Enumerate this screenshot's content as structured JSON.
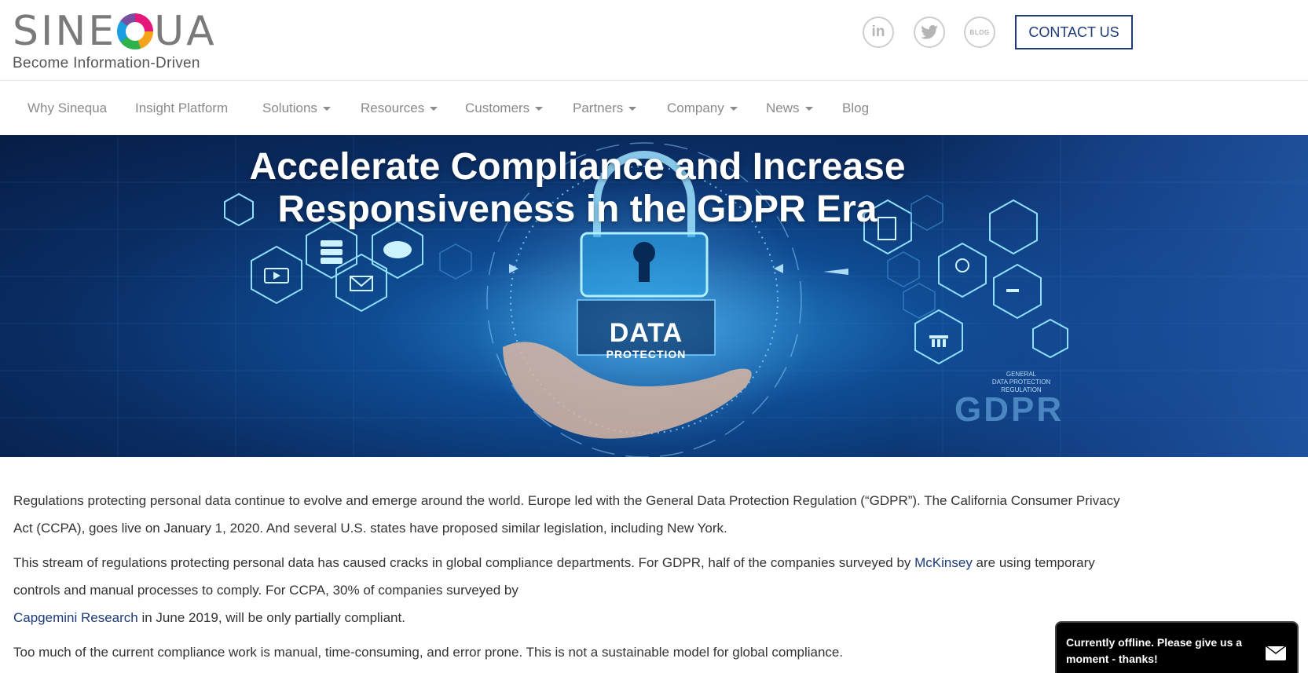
{
  "brand": {
    "logo_pre": "SINE",
    "logo_post": "UA",
    "tagline": "Become Information-Driven"
  },
  "header": {
    "social": [
      {
        "label": "in",
        "icon": "linkedin-icon"
      },
      {
        "label": "🐦",
        "icon": "twitter-icon"
      },
      {
        "label": "BLOG",
        "icon": "blog-icon"
      }
    ],
    "contact_label": "CONTACT US"
  },
  "nav": {
    "items": [
      {
        "label": "Why Sinequa",
        "dropdown": false
      },
      {
        "label": "Insight Platform",
        "dropdown": false
      },
      {
        "label": "Solutions",
        "dropdown": true
      },
      {
        "label": "Resources",
        "dropdown": true
      },
      {
        "label": "Customers",
        "dropdown": true
      },
      {
        "label": "Partners",
        "dropdown": true
      },
      {
        "label": "Company",
        "dropdown": true
      },
      {
        "label": "News",
        "dropdown": true
      },
      {
        "label": "Blog",
        "dropdown": false
      }
    ]
  },
  "hero": {
    "title_line1": "Accelerate Compliance and Increase",
    "title_line2": "Responsiveness in the GDPR Era",
    "data_big": "DATA",
    "data_small": "PROTECTION",
    "gdpr_small_1": "GENERAL",
    "gdpr_small_2": "DATA PROTECTION",
    "gdpr_small_3": "REGULATION",
    "gdpr_big": "GDPR"
  },
  "content": {
    "p1": "Regulations protecting personal data continue to evolve and emerge around the world. Europe led with the General Data Protection Regulation (“GDPR”). The California Consumer Privacy Act (CCPA), goes live on January 1, 2020. And several U.S. states have proposed similar legislation, including New York.",
    "p2_a": "This stream of regulations protecting personal data has caused cracks in global compliance departments. For GDPR, half of the companies surveyed by ",
    "p2_link1": "McKinsey",
    "p2_b": " are using temporary controls and manual processes to comply. For CCPA, 30% of companies surveyed by",
    "p2_link2": "Capgemini Research",
    "p2_c": " in June 2019, will be only partially compliant.",
    "p3": "Too much of the current compliance work is manual, time-consuming, and error prone. This is not a sustainable model for global compliance."
  },
  "chat": {
    "message": "Currently offline. Please give us a moment - thanks!"
  },
  "colors": {
    "brand_navy": "#1d3c78",
    "nav_text": "#8a8a8a",
    "hero_blue": "#0f4c94"
  }
}
